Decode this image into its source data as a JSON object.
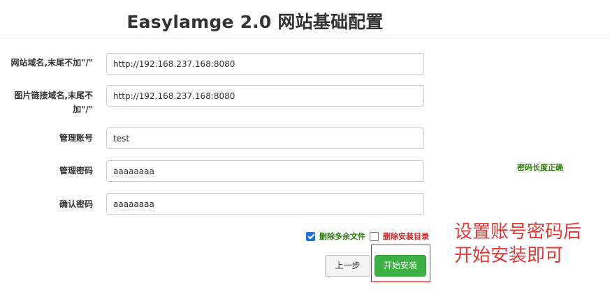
{
  "header": {
    "title": "Easylamge 2.0 网站基础配置"
  },
  "form": {
    "site_domain": {
      "label": "网站域名,末尾不加\"/\"",
      "value": "http://192.168.237.168:8080"
    },
    "image_domain": {
      "label_line1": "图片链接域名,末尾不",
      "label_line2": "加\"/\"",
      "value": "http://192.168.237.168:8080"
    },
    "admin_account": {
      "label": "管理账号",
      "value": "test"
    },
    "admin_password": {
      "label": "管理密码",
      "value": "aaaaaaaa",
      "hint": "密码长度正确"
    },
    "confirm_password": {
      "label": "确认密码",
      "value": "aaaaaaaa"
    }
  },
  "options": {
    "delete_extra_files": {
      "label": "删除多余文件",
      "checked": true
    },
    "delete_install_dir": {
      "label": "删除安装目录",
      "checked": false
    }
  },
  "buttons": {
    "prev": "上一步",
    "install": "开始安装"
  },
  "annotation": {
    "line1": "设置账号密码后",
    "line2": "开始安装即可"
  },
  "colors": {
    "accent_green": "#3cb043",
    "hint_green": "#2e7d0e",
    "warning_red": "#c62828",
    "annotation_red": "#e53935",
    "checkbox_blue": "#1a73e8"
  }
}
